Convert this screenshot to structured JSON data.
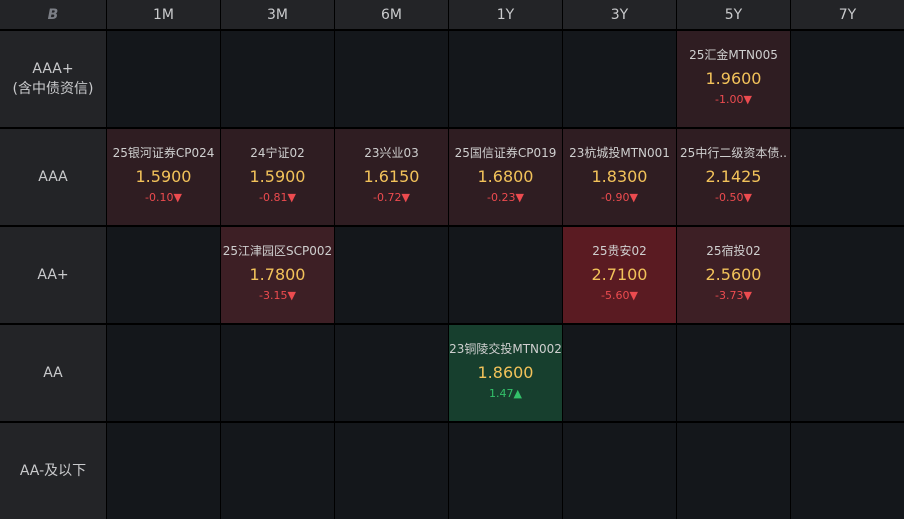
{
  "corner_logo": "B",
  "columns": [
    "1M",
    "3M",
    "6M",
    "1Y",
    "3Y",
    "5Y",
    "7Y"
  ],
  "rows": [
    {
      "line1": "AAA+",
      "line2": "(含中债资信)"
    },
    {
      "line1": "AAA",
      "line2": ""
    },
    {
      "line1": "AA+",
      "line2": ""
    },
    {
      "line1": "AA",
      "line2": ""
    },
    {
      "line1": "AA-及以下",
      "line2": ""
    }
  ],
  "bonds": [
    {
      "name": "25汇金MTN005",
      "yield": "1.9600",
      "change": "-1.00▼",
      "direction": "down",
      "tint": "light"
    },
    {
      "name": "25银河证券CP024",
      "yield": "1.5900",
      "change": "-0.10▼",
      "direction": "down",
      "tint": "light"
    },
    {
      "name": "24宁证02",
      "yield": "1.5900",
      "change": "-0.81▼",
      "direction": "down",
      "tint": "light"
    },
    {
      "name": "23兴业03",
      "yield": "1.6150",
      "change": "-0.72▼",
      "direction": "down",
      "tint": "light"
    },
    {
      "name": "25国信证券CP019",
      "yield": "1.6800",
      "change": "-0.23▼",
      "direction": "down",
      "tint": "light"
    },
    {
      "name": "23杭城投MTN001",
      "yield": "1.8300",
      "change": "-0.90▼",
      "direction": "down",
      "tint": "light"
    },
    {
      "name": "25中行二级资本债..",
      "yield": "2.1425",
      "change": "-0.50▼",
      "direction": "down",
      "tint": "light"
    },
    {
      "name": "25江津园区SCP002",
      "yield": "1.7800",
      "change": "-3.15▼",
      "direction": "down",
      "tint": "mid"
    },
    {
      "name": "25贵安02",
      "yield": "2.7100",
      "change": "-5.60▼",
      "direction": "down",
      "tint": "strong"
    },
    {
      "name": "25宿投02",
      "yield": "2.5600",
      "change": "-3.73▼",
      "direction": "down",
      "tint": "mid"
    },
    {
      "name": "23铜陵交投MTN002",
      "yield": "1.8600",
      "change": "1.47▲",
      "direction": "up",
      "tint": "green"
    }
  ],
  "colors": {
    "negative": "#ec4b4f",
    "positive": "#33c26a",
    "yield": "#f2c25a"
  }
}
